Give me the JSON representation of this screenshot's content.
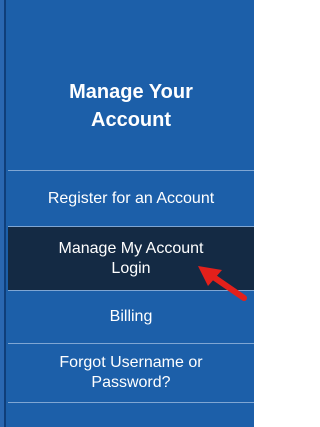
{
  "header": {
    "title_line1": "Manage Your",
    "title_line2": "Account"
  },
  "menu": {
    "items": [
      {
        "label": "Register for an Account"
      },
      {
        "label_line1": "Manage My Account",
        "label_line2": "Login"
      },
      {
        "label": "Billing"
      },
      {
        "label_line1": "Forgot Username or",
        "label_line2": "Password?"
      }
    ]
  },
  "colors": {
    "panel_background": "#1c5fa9",
    "active_item_background": "#142a44",
    "divider": "#7fa6d3",
    "annotation_arrow": "#e3201b"
  },
  "icons": {
    "annotation": "red-arrow-icon"
  }
}
